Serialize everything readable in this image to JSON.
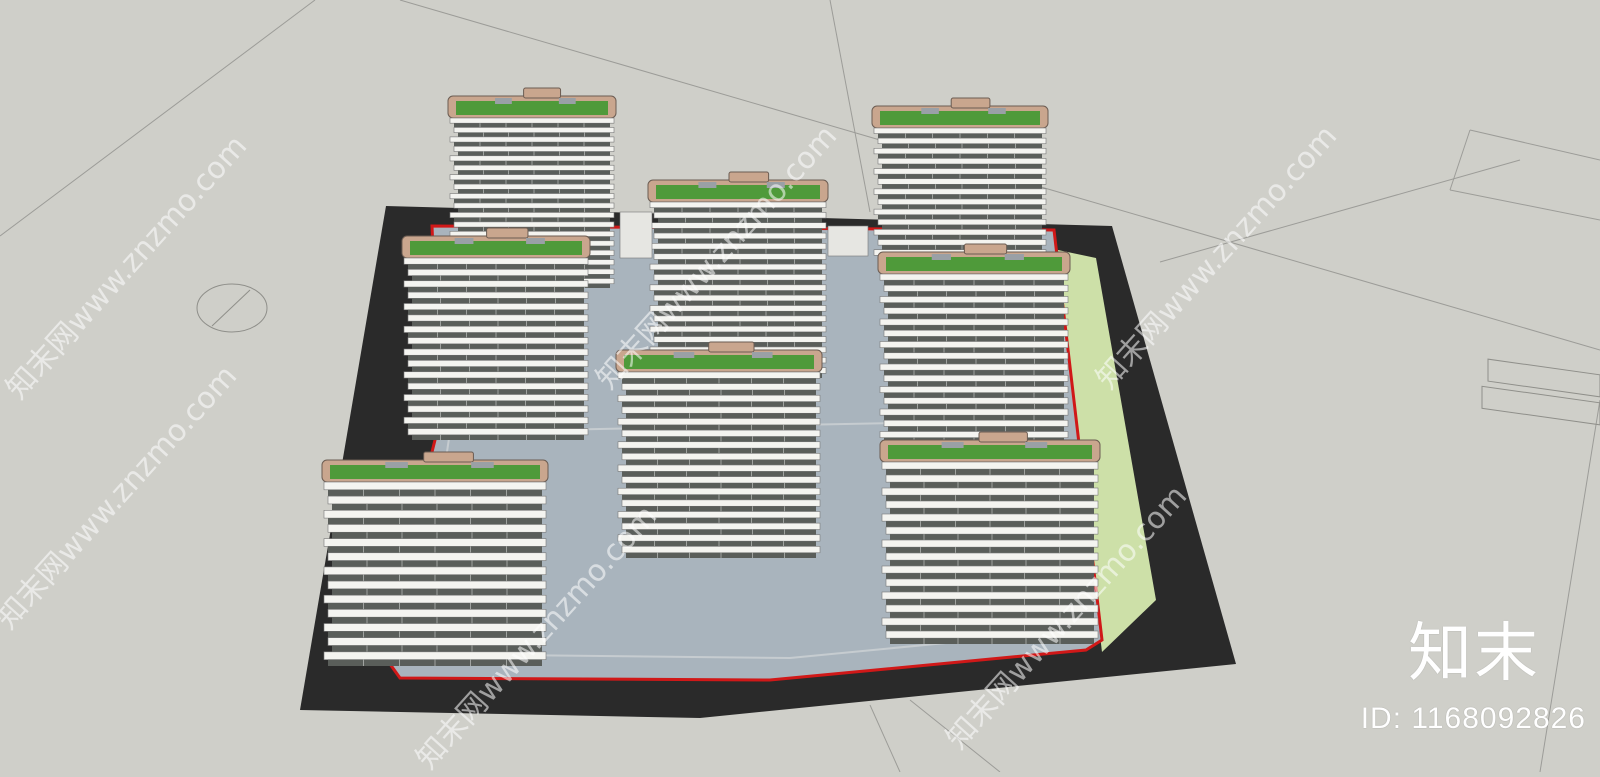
{
  "brand": {
    "name": "知末",
    "id_text": "ID: 1168092826"
  },
  "watermark": {
    "text": "知末网www.znzmo.com"
  },
  "colors": {
    "background": "#cfcfc9",
    "asphalt": "#2a2a2a",
    "plaza": "#a9b4bd",
    "lawn": "#cde0a8",
    "boundary": "#d01818",
    "roof_green": "#4f9a3a",
    "roof_trim": "#c9a68e",
    "slab": "#f4f4f0",
    "window_band": "#5a5e5a"
  },
  "icons": [
    "north-arrow-icon"
  ]
}
